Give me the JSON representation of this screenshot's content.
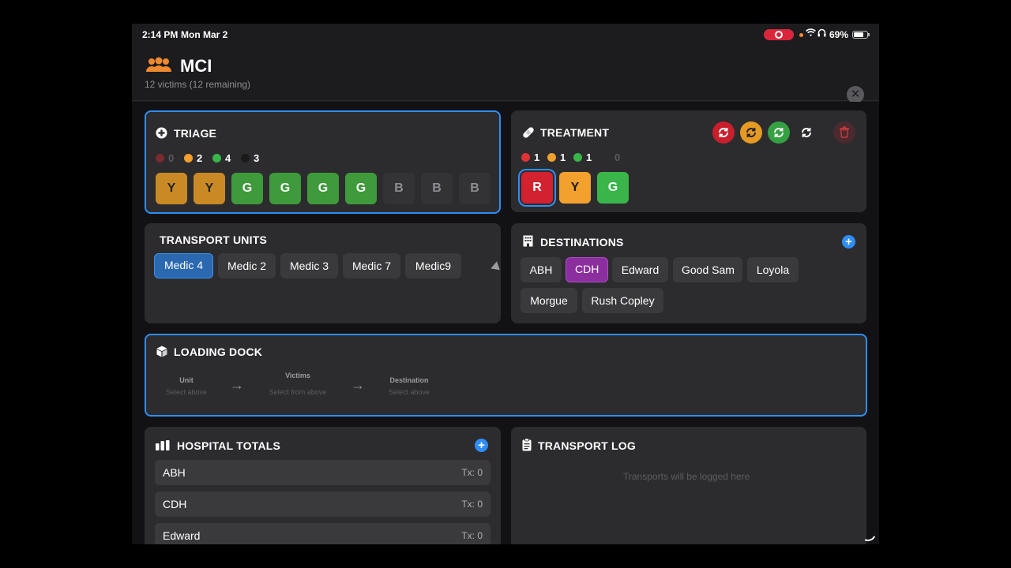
{
  "status_bar": {
    "time": "2:14 PM",
    "date": "Mon Mar 2",
    "battery": "69%"
  },
  "header": {
    "title": "MCI",
    "subtitle": "12 victims (12 remaining)",
    "close_label": "✕"
  },
  "triage": {
    "title": "TRIAGE",
    "counts": [
      {
        "value": "0",
        "color": "#7a2a30"
      },
      {
        "value": "2",
        "color": "#f2a02e"
      },
      {
        "value": "4",
        "color": "#39b54a"
      },
      {
        "value": "3",
        "color": "#2a2a2a"
      }
    ],
    "tiles": [
      "Y",
      "Y",
      "G",
      "G",
      "G",
      "G",
      "B",
      "B",
      "B"
    ]
  },
  "treatment": {
    "title": "TREATMENT",
    "counts": [
      {
        "value": "1",
        "color": "#e03434"
      },
      {
        "value": "1",
        "color": "#f2a02e"
      },
      {
        "value": "1",
        "color": "#39b54a"
      },
      {
        "value": "0",
        "color": "#2c2c2e"
      }
    ],
    "tiles": [
      "R",
      "Y",
      "G"
    ],
    "action_icons": [
      "red-refresh-icon",
      "yellow-refresh-icon",
      "green-refresh-icon",
      "white-refresh-icon",
      "trash-icon"
    ]
  },
  "transport_units": {
    "title": "TRANSPORT UNITS",
    "units": [
      "Medic 4",
      "Medic 2",
      "Medic 3",
      "Medic 7",
      "Medic9"
    ]
  },
  "destinations": {
    "title": "DESTINATIONS",
    "items": [
      "ABH",
      "CDH",
      "Edward",
      "Good Sam",
      "Loyola",
      "Morgue",
      "Rush Copley"
    ]
  },
  "loading_dock": {
    "title": "LOADING DOCK",
    "steps": [
      {
        "label": "Unit",
        "hint": "Select above"
      },
      {
        "label": "Victims",
        "hint": "Select from above"
      },
      {
        "label": "Destination",
        "hint": "Select above"
      }
    ],
    "arrow": "→"
  },
  "hospital_totals": {
    "title": "HOSPITAL TOTALS",
    "rows": [
      {
        "name": "ABH",
        "tx": "Tx: 0"
      },
      {
        "name": "CDH",
        "tx": "Tx: 0"
      },
      {
        "name": "Edward",
        "tx": "Tx: 0"
      }
    ]
  },
  "transport_log": {
    "title": "TRANSPORT LOG",
    "empty": "Transports will be logged here"
  },
  "colors": {
    "accent": "#2f8df5",
    "selected_unit": "#2a68b0",
    "selected_destination": "#8b2e9e",
    "header_icon": "#f0892f"
  }
}
